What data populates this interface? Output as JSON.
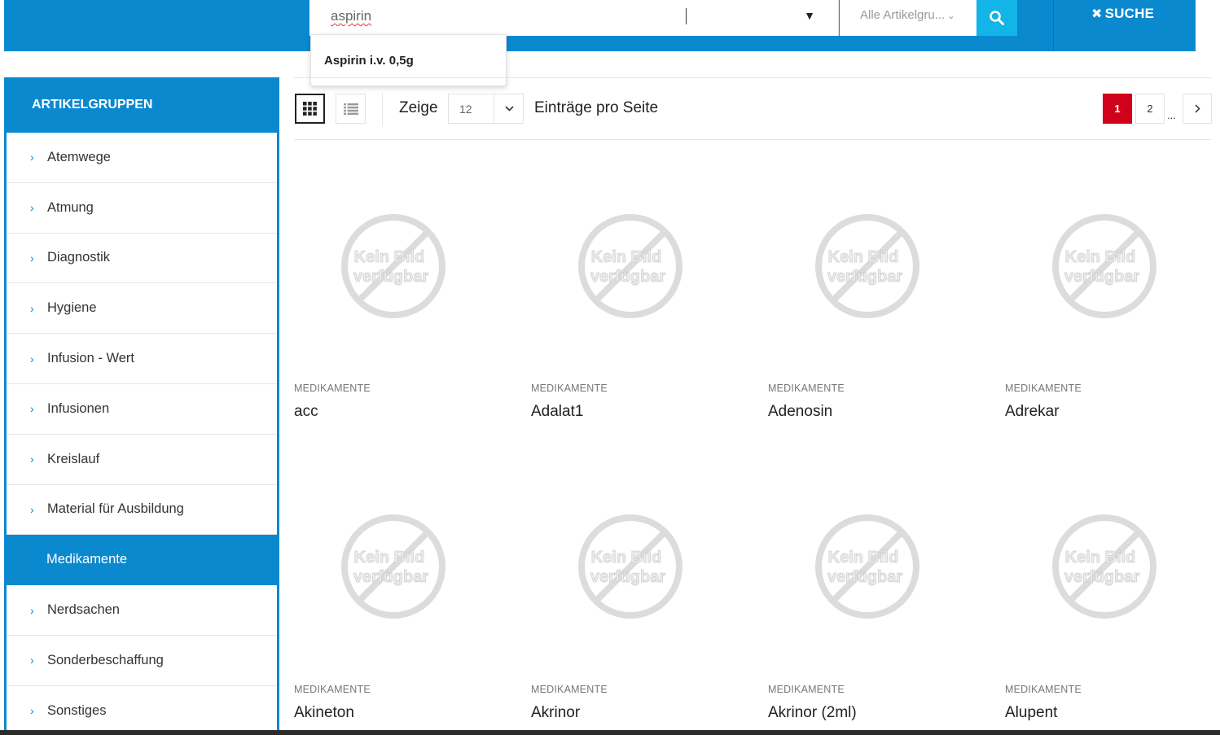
{
  "header": {
    "search_value": "aspirin",
    "category_select": "Alle Artikelgru...",
    "close_search_label": "SUCHE",
    "suggestion": "Aspirin i.v. 0,5g"
  },
  "sidebar": {
    "title": "ARTIKELGRUPPEN",
    "items": [
      {
        "label": "Atemwege"
      },
      {
        "label": "Atmung"
      },
      {
        "label": "Diagnostik"
      },
      {
        "label": "Hygiene"
      },
      {
        "label": "Infusion - Wert"
      },
      {
        "label": "Infusionen"
      },
      {
        "label": "Kreislauf"
      },
      {
        "label": "Material für Ausbildung"
      },
      {
        "label": "Medikamente"
      },
      {
        "label": "Nerdsachen"
      },
      {
        "label": "Sonderbeschaffung"
      },
      {
        "label": "Sonstiges"
      }
    ],
    "active_item": "Medikamente"
  },
  "toolbar": {
    "show_label": "Zeige",
    "per_page_value": "12",
    "per_page_label": "Einträge pro Seite",
    "pages": [
      "1",
      "2"
    ],
    "current_page": "1",
    "ellipsis": "..."
  },
  "colors": {
    "brand_blue": "#0a89cf",
    "search_button": "#13b4e8",
    "active_page": "#d0021b"
  },
  "placeholder_image": {
    "line1": "Kein Bild",
    "line2": "verfügbar"
  },
  "products": [
    {
      "category": "MEDIKAMENTE",
      "name": "acc"
    },
    {
      "category": "MEDIKAMENTE",
      "name": "Adalat1"
    },
    {
      "category": "MEDIKAMENTE",
      "name": "Adenosin"
    },
    {
      "category": "MEDIKAMENTE",
      "name": "Adrekar"
    },
    {
      "category": "MEDIKAMENTE",
      "name": "Akineton"
    },
    {
      "category": "MEDIKAMENTE",
      "name": "Akrinor"
    },
    {
      "category": "MEDIKAMENTE",
      "name": "Akrinor (2ml)"
    },
    {
      "category": "MEDIKAMENTE",
      "name": "Alupent"
    }
  ]
}
